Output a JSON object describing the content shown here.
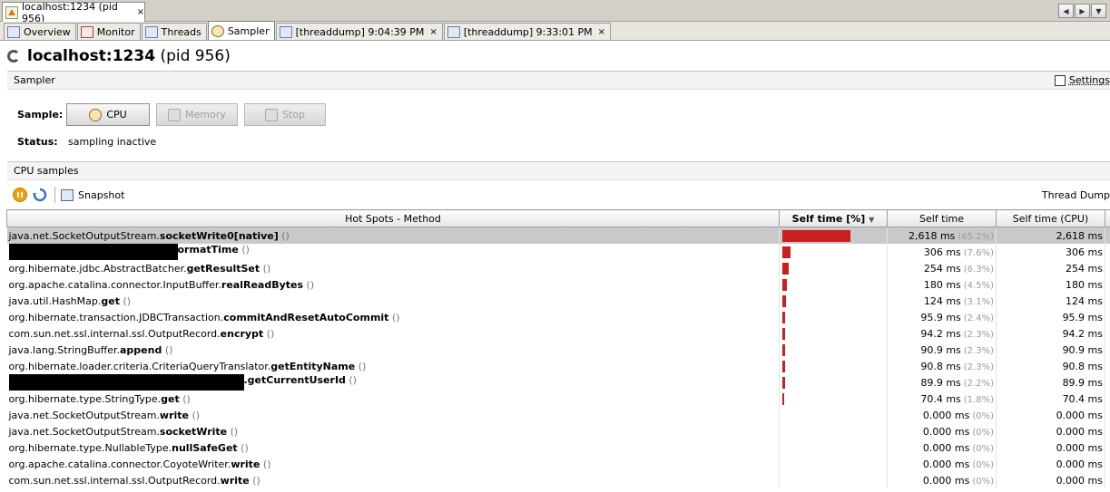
{
  "window": {
    "tab_title": "localhost:1234 (pid 956)",
    "close_glyph": "×",
    "nav": [
      "◀",
      "▶",
      "▼"
    ]
  },
  "view_tabs": [
    {
      "label": "Overview",
      "icon": "overview-icon",
      "closable": false,
      "active": false
    },
    {
      "label": "Monitor",
      "icon": "monitor-icon",
      "closable": false,
      "active": false
    },
    {
      "label": "Threads",
      "icon": "threads-icon",
      "closable": false,
      "active": false
    },
    {
      "label": "Sampler",
      "icon": "sampler-icon",
      "closable": false,
      "active": true
    },
    {
      "label": "[threaddump] 9:04:39 PM",
      "icon": "threaddump-icon",
      "closable": true,
      "active": false
    },
    {
      "label": "[threaddump] 9:33:01 PM",
      "icon": "threaddump-icon",
      "closable": true,
      "active": false
    }
  ],
  "page": {
    "title_host": "localhost:1234",
    "title_pid": "(pid 956)"
  },
  "sampler": {
    "header": "Sampler",
    "settings_label": "Settings",
    "sample_label": "Sample:",
    "buttons": {
      "cpu": "CPU",
      "memory": "Memory",
      "stop": "Stop"
    },
    "status_label": "Status:",
    "status_value": "sampling inactive"
  },
  "cpu_samples": {
    "header": "CPU samples",
    "snapshot_label": "Snapshot",
    "thread_dump_label": "Thread Dump",
    "columns": {
      "method": "Hot Spots - Method",
      "self_pct": "Self time [%]",
      "self_time": "Self time",
      "self_cpu": "Self time (CPU)"
    },
    "rows": [
      {
        "pkg": "java.net.SocketOutputStream.",
        "method": "socketWrite0[native]",
        "args": " ()",
        "redacted": false,
        "pct_value": 65.2,
        "self_time": "2,618 ms",
        "pct": "(65.2%)",
        "cpu": "2,618 ms"
      },
      {
        "pkg": "",
        "method": "ormatTime",
        "args": " ()",
        "redacted": true,
        "pct_value": 7.6,
        "self_time": "306 ms",
        "pct": "(7.6%)",
        "cpu": "306 ms"
      },
      {
        "pkg": "org.hibernate.jdbc.AbstractBatcher.",
        "method": "getResultSet",
        "args": " ()",
        "redacted": false,
        "pct_value": 6.3,
        "self_time": "254 ms",
        "pct": "(6.3%)",
        "cpu": "254 ms"
      },
      {
        "pkg": "org.apache.catalina.connector.InputBuffer.",
        "method": "realReadBytes",
        "args": " ()",
        "redacted": false,
        "pct_value": 4.5,
        "self_time": "180 ms",
        "pct": "(4.5%)",
        "cpu": "180 ms"
      },
      {
        "pkg": "java.util.HashMap.",
        "method": "get",
        "args": " ()",
        "redacted": false,
        "pct_value": 3.1,
        "self_time": "124 ms",
        "pct": "(3.1%)",
        "cpu": "124 ms"
      },
      {
        "pkg": "org.hibernate.transaction.JDBCTransaction.",
        "method": "commitAndResetAutoCommit",
        "args": " ()",
        "redacted": false,
        "pct_value": 2.4,
        "self_time": "95.9 ms",
        "pct": "(2.4%)",
        "cpu": "95.9 ms"
      },
      {
        "pkg": "com.sun.net.ssl.internal.ssl.OutputRecord.",
        "method": "encrypt",
        "args": " ()",
        "redacted": false,
        "pct_value": 2.3,
        "self_time": "94.2 ms",
        "pct": "(2.3%)",
        "cpu": "94.2 ms"
      },
      {
        "pkg": "java.lang.StringBuffer.",
        "method": "append",
        "args": " ()",
        "redacted": false,
        "pct_value": 2.3,
        "self_time": "90.9 ms",
        "pct": "(2.3%)",
        "cpu": "90.9 ms"
      },
      {
        "pkg": "org.hibernate.loader.criteria.CriteriaQueryTranslator.",
        "method": "getEntityName",
        "args": " ()",
        "redacted": false,
        "pct_value": 2.3,
        "self_time": "90.8 ms",
        "pct": "(2.3%)",
        "cpu": "90.8 ms"
      },
      {
        "pkg": "",
        "method": ".getCurrentUserId",
        "args": " ()",
        "redacted": true,
        "pct_value": 2.2,
        "self_time": "89.9 ms",
        "pct": "(2.2%)",
        "cpu": "89.9 ms"
      },
      {
        "pkg": "org.hibernate.type.StringType.",
        "method": "get",
        "args": " ()",
        "redacted": false,
        "pct_value": 1.8,
        "self_time": "70.4 ms",
        "pct": "(1.8%)",
        "cpu": "70.4 ms"
      },
      {
        "pkg": "java.net.SocketOutputStream.",
        "method": "write",
        "args": " ()",
        "redacted": false,
        "pct_value": 0,
        "self_time": "0.000 ms",
        "pct": "(0%)",
        "cpu": "0.000 ms"
      },
      {
        "pkg": "java.net.SocketOutputStream.",
        "method": "socketWrite",
        "args": " ()",
        "redacted": false,
        "pct_value": 0,
        "self_time": "0.000 ms",
        "pct": "(0%)",
        "cpu": "0.000 ms"
      },
      {
        "pkg": "org.hibernate.type.NullableType.",
        "method": "nullSafeGet",
        "args": " ()",
        "redacted": false,
        "pct_value": 0,
        "self_time": "0.000 ms",
        "pct": "(0%)",
        "cpu": "0.000 ms"
      },
      {
        "pkg": "org.apache.catalina.connector.CoyoteWriter.",
        "method": "write",
        "args": " ()",
        "redacted": false,
        "pct_value": 0,
        "self_time": "0.000 ms",
        "pct": "(0%)",
        "cpu": "0.000 ms"
      },
      {
        "pkg": "com.sun.net.ssl.internal.ssl.OutputRecord.",
        "method": "write",
        "args": " ()",
        "redacted": false,
        "pct_value": 0,
        "self_time": "0.000 ms",
        "pct": "(0%)",
        "cpu": "0.000 ms"
      }
    ]
  },
  "colors": {
    "bar": "#c82020",
    "selected_row": "#c9c9c9",
    "pause_icon": "#f2a100",
    "refresh_icon": "#3a73c8"
  }
}
